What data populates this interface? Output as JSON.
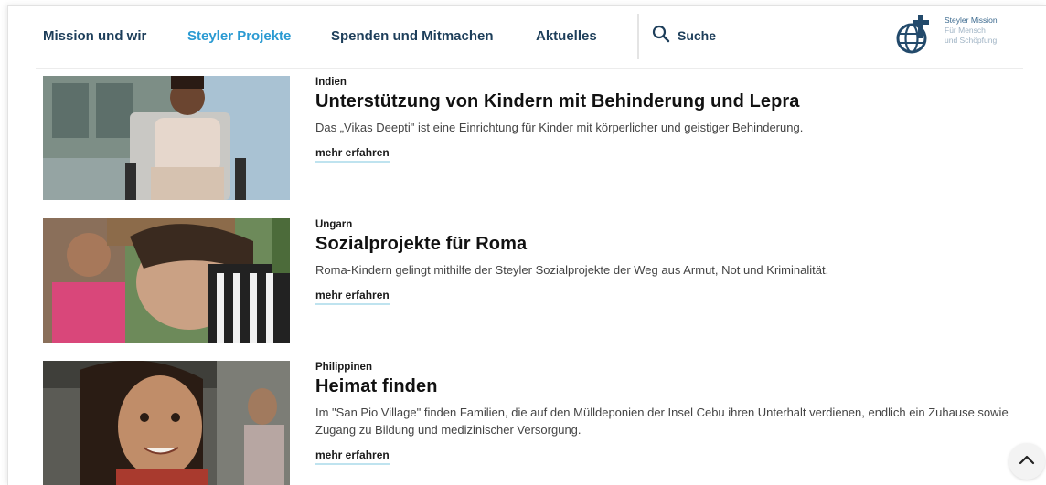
{
  "nav": {
    "items": [
      {
        "label": "Mission und wir"
      },
      {
        "label": "Steyler Projekte"
      },
      {
        "label": "Spenden und Mitmachen"
      },
      {
        "label": "Aktuelles"
      }
    ],
    "active_color": "#2a9ad2",
    "text_color": "#1d3e5a"
  },
  "search": {
    "label": "Suche",
    "icon": "search-icon"
  },
  "logo": {
    "line1": "Steyler Mission",
    "line2": "Für Mensch",
    "line3": "und Schöpfung",
    "icon": "globe-cross-logo"
  },
  "projects": [
    {
      "country": "Indien",
      "title": "Unterstützung von Kindern mit Behinderung und Lepra",
      "description": "Das „Vikas Deepti\" ist eine Einrichtung für Kinder mit körperlicher und geistiger Behinderung.",
      "link": "mehr erfahren"
    },
    {
      "country": "Ungarn",
      "title": "Sozialprojekte für Roma",
      "description": "Roma-Kindern gelingt mithilfe der Steyler Sozialprojekte der Weg aus Armut, Not und Kriminalität.",
      "link": "mehr erfahren"
    },
    {
      "country": "Philippinen",
      "title": "Heimat finden",
      "description": "Im \"San Pio Village\" finden Familien, die auf den Mülldeponien der Insel Cebu ihren Unterhalt verdienen, endlich ein Zuhause sowie Zugang zu Bildung und medizinischer Versorgung.",
      "link": "mehr erfahren"
    }
  ],
  "scroll_top": {
    "icon": "chevron-up-icon"
  }
}
